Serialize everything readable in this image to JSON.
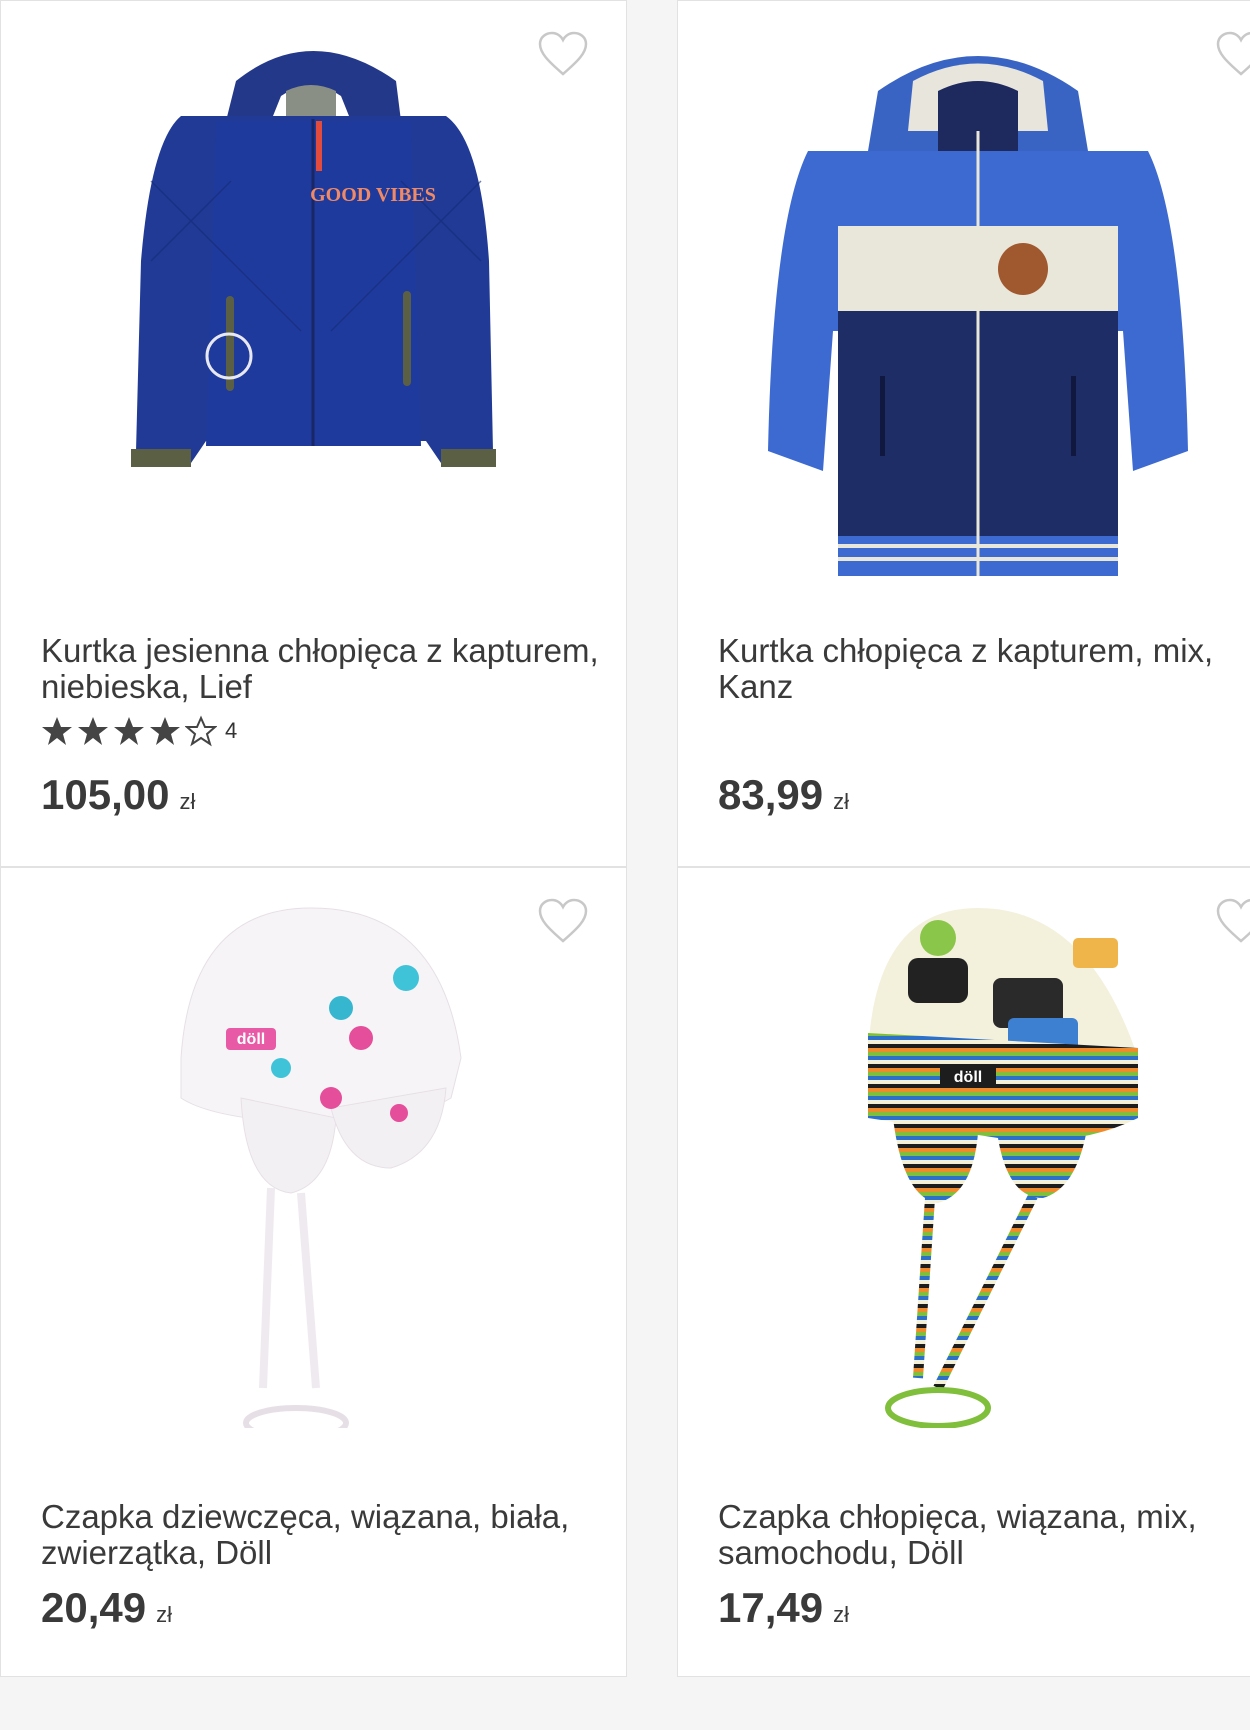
{
  "products": [
    {
      "title": "Kurtka jesienna chłopięca z kapturem, niebieska, Lief",
      "rating": 4,
      "rating_count": "4",
      "price": "105,00",
      "currency": "zł",
      "image_icon": "blue-quilted-jacket-image",
      "image_print": "GOOD VIBES"
    },
    {
      "title": "Kurtka chłopięca z kapturem, mix, Kanz",
      "price": "83,99",
      "currency": "zł",
      "image_icon": "blue-padded-jacket-image"
    },
    {
      "title": "Czapka dziewczęca, wiązana, biała, zwierzątka, Döll",
      "price": "20,49",
      "currency": "zł",
      "image_icon": "white-patterned-hat-image",
      "image_print": "döll"
    },
    {
      "title": "Czapka chłopięca, wiązana, mix, samochodu, Döll",
      "price": "17,49",
      "currency": "zł",
      "image_icon": "striped-car-hat-image",
      "image_print": "döll"
    }
  ],
  "colors": {
    "heart_outline": "#c8c8c8",
    "star": "#444444",
    "card_border": "#e2e2e2",
    "background": "#f5f5f5"
  }
}
